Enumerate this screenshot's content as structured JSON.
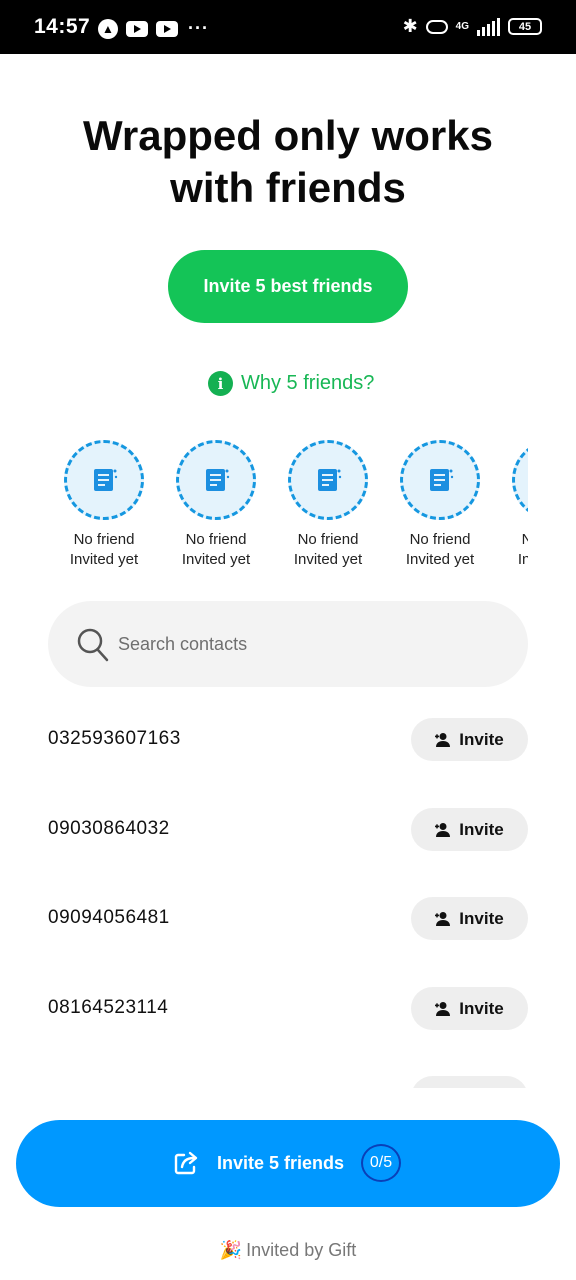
{
  "status_bar": {
    "time": "14:57",
    "network": "4G",
    "battery": "45"
  },
  "header": {
    "title_line1": "Wrapped only works",
    "title_line2": "with friends"
  },
  "primary_button": {
    "label": "Invite 5 best friends"
  },
  "why_link": {
    "label": "Why 5 friends?"
  },
  "friend_slots": [
    {
      "line1": "No friend",
      "line2": "Invited yet"
    },
    {
      "line1": "No friend",
      "line2": "Invited yet"
    },
    {
      "line1": "No friend",
      "line2": "Invited yet"
    },
    {
      "line1": "No friend",
      "line2": "Invited yet"
    },
    {
      "line1": "No friend",
      "line2": "Invited yet"
    }
  ],
  "search": {
    "placeholder": "Search contacts"
  },
  "contacts": [
    {
      "phone": "032593607163",
      "button": "Invite"
    },
    {
      "phone": "09030864032",
      "button": "Invite"
    },
    {
      "phone": "09094056481",
      "button": "Invite"
    },
    {
      "phone": "08164523114",
      "button": "Invite"
    },
    {
      "phone": "",
      "button": ""
    }
  ],
  "cta": {
    "label": "Invite 5 friends",
    "count": "0/5"
  },
  "footer": {
    "text": "Invited by Gift",
    "emoji": "🎉"
  },
  "colors": {
    "green": "#14c457",
    "blue": "#0098ff",
    "slot_ring": "#1597e0"
  }
}
